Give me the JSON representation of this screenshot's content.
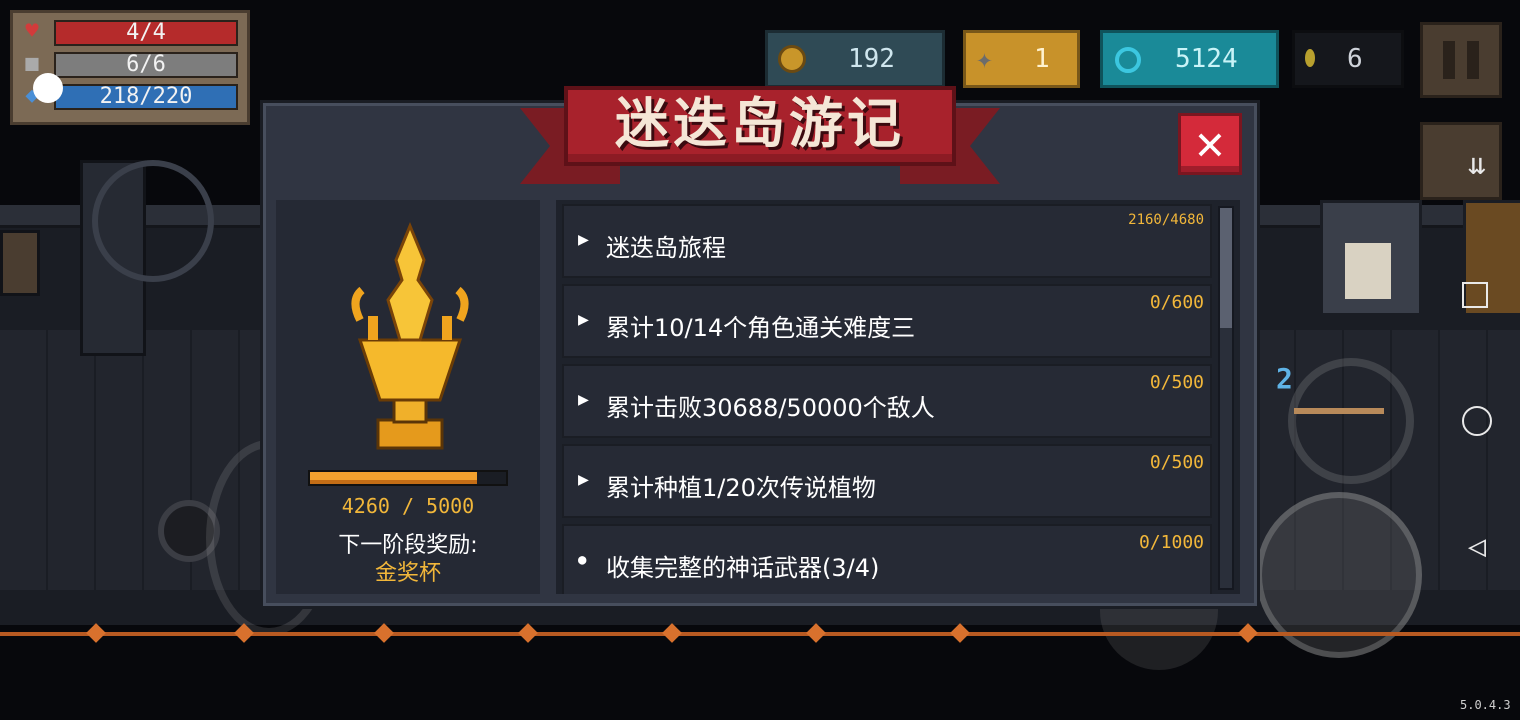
{
  "hud": {
    "hp": "4/4",
    "armor": "6/6",
    "energy": "218/220",
    "hp_icon": "heart-icon",
    "armor_icon": "shield-icon",
    "energy_icon": "energy-crystal-icon"
  },
  "currencies": {
    "gold": "192",
    "fish": "1",
    "gems": "5124",
    "seeds": "6"
  },
  "dialog": {
    "title": "迷迭岛游记",
    "close_symbol": "✕",
    "progress_text": "4260 / 5000",
    "progress_fraction": 0.852,
    "next_reward_label": "下一阶段奖励:",
    "next_reward_value": "金奖杯",
    "tasks": [
      {
        "label": "迷迭岛旅程",
        "points": "2160/4680",
        "marker": "▶"
      },
      {
        "label": "累计10/14个角色通关难度三",
        "points": "0/600",
        "marker": "▶"
      },
      {
        "label": "累计击败30688/50000个敌人",
        "points": "0/500",
        "marker": "▶"
      },
      {
        "label": "累计种植1/20次传说植物",
        "points": "0/500",
        "marker": "▶"
      },
      {
        "label": "收集完整的神话武器(3/4)",
        "points": "0/1000",
        "marker": "●"
      }
    ]
  },
  "weapon_slot": "2",
  "version": "5.0.4.3",
  "colors": {
    "accent_gold": "#f2b73a",
    "title_red": "#a8222c",
    "panel": "#303542"
  }
}
